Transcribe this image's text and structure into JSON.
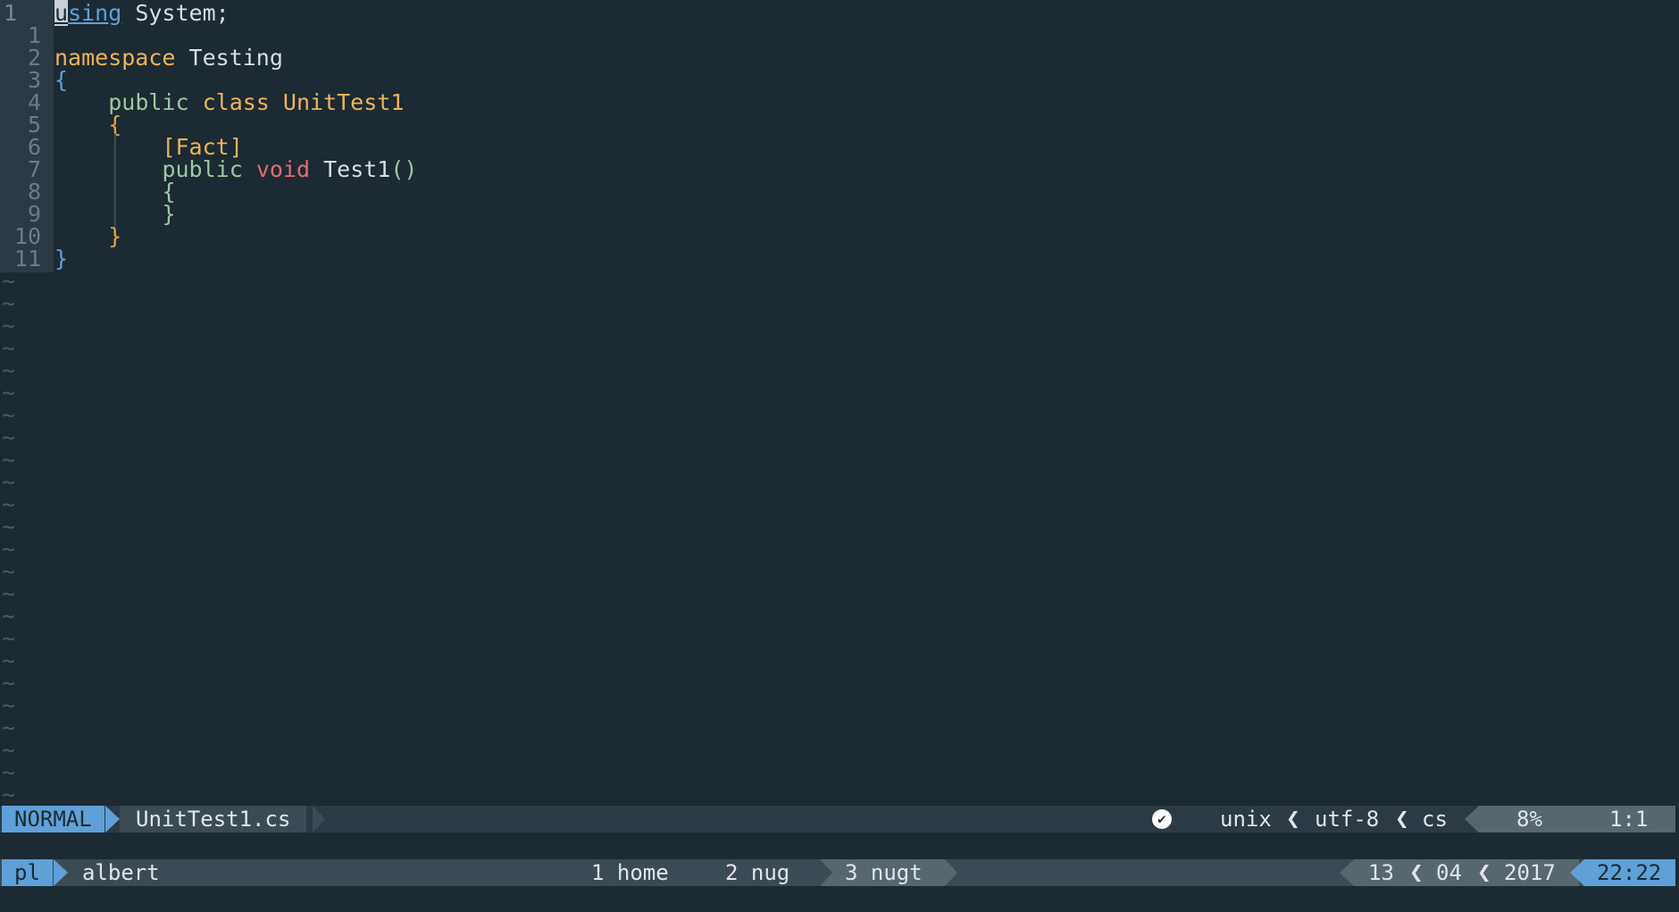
{
  "editor": {
    "lines": [
      {
        "num": "1",
        "current": true
      },
      {
        "num": "1"
      },
      {
        "num": "2"
      },
      {
        "num": "3"
      },
      {
        "num": "4"
      },
      {
        "num": "5"
      },
      {
        "num": "6"
      },
      {
        "num": "7"
      },
      {
        "num": "8"
      },
      {
        "num": "9"
      },
      {
        "num": "10"
      },
      {
        "num": "11"
      }
    ],
    "tokens": {
      "using_first": "u",
      "using_rest": "sing",
      "system": " System;",
      "namespace_kw": "namespace",
      "namespace_name": " Testing",
      "open_brace": "{",
      "public_kw": "public",
      "class_kw": "class",
      "class_name": "UnitTest1",
      "fact_attr": "[Fact]",
      "void_kw": "void",
      "method_name": "Test1",
      "parens": "()",
      "close_brace": "}",
      "guide": "│",
      "tilde": "~"
    }
  },
  "statusline": {
    "mode": "NORMAL",
    "filename": "UnitTest1.cs",
    "check_icon": "check-circle-icon",
    "fileformat": "unix",
    "encoding": "utf-8",
    "filetype": "cs",
    "percent": "8%",
    "position": "1:1",
    "sep": "❮"
  },
  "tmux": {
    "session": "pl",
    "user": "albert",
    "windows": [
      {
        "label": "1 home"
      },
      {
        "label": "2 nug"
      },
      {
        "label": "3 nugt",
        "active": true
      }
    ],
    "day": "13",
    "month": "04",
    "year": "2017",
    "time": "22:22"
  },
  "colors": {
    "background": "#1b2a33",
    "accent": "#5fa0d8",
    "orange": "#f0b35a",
    "red": "#e06c75",
    "green": "#9cc8a0"
  }
}
